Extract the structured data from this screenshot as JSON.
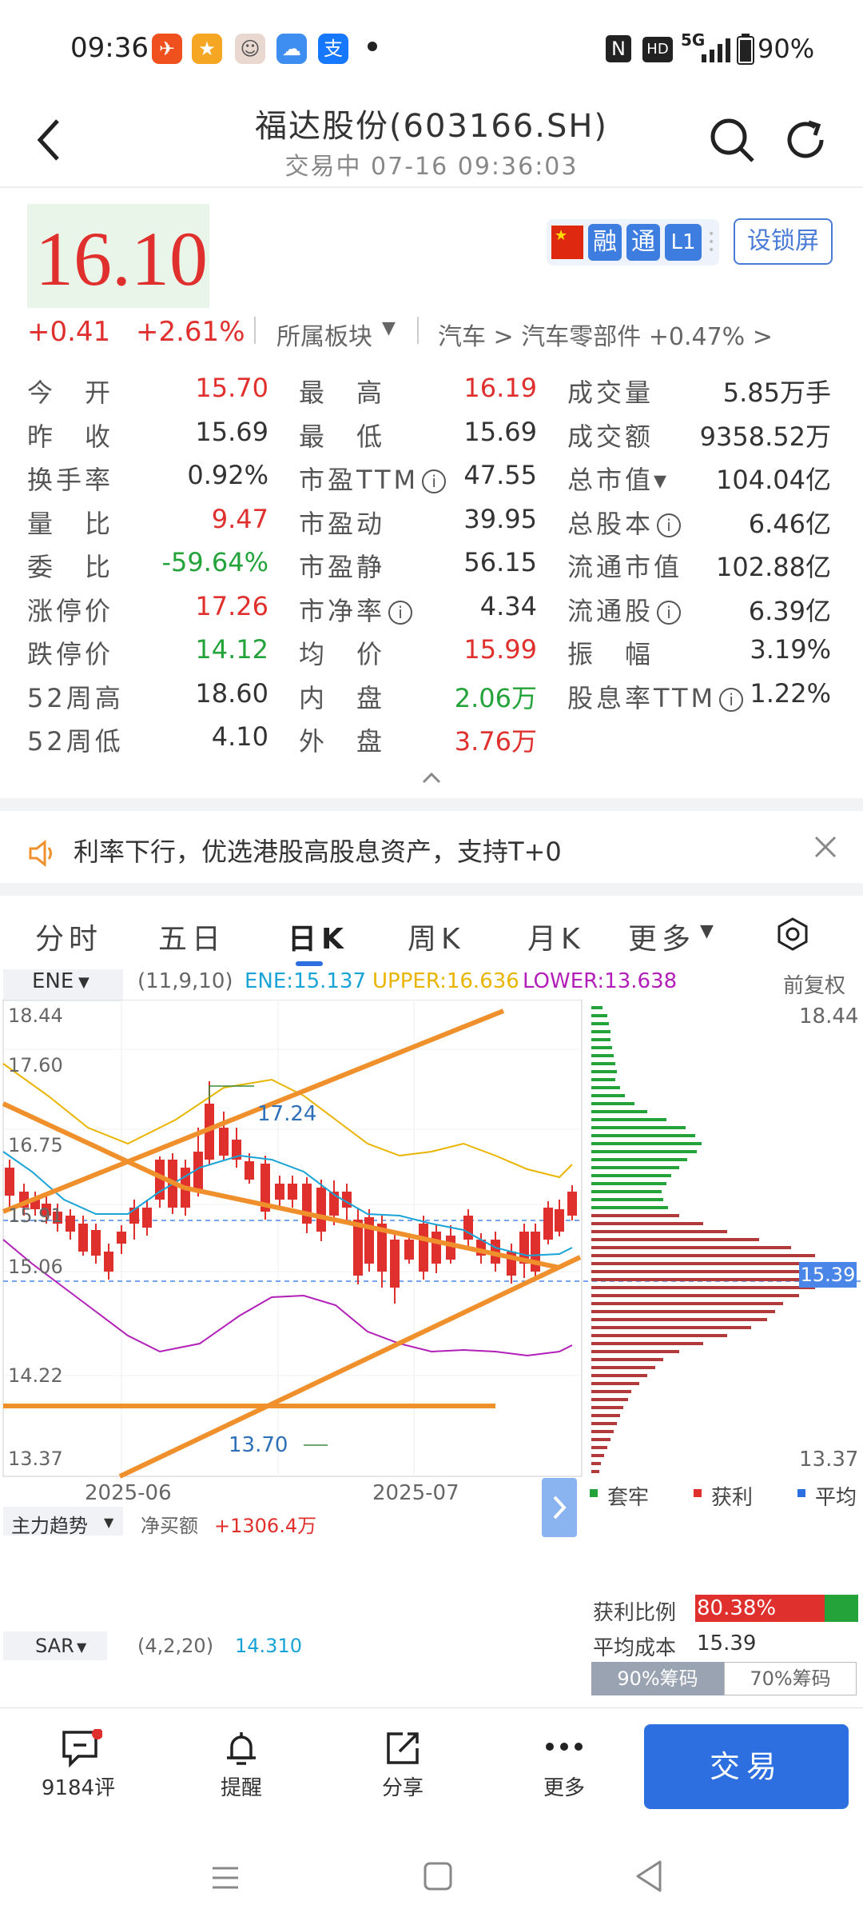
{
  "status_bar": {
    "time": "09:36",
    "battery": "90%",
    "network": "5G",
    "hd": "HD",
    "nfc": "N"
  },
  "nav": {
    "title": "福达股份(603166.SH)",
    "subtitle": "交易中 07-16 09:36:03"
  },
  "quote": {
    "price": "16.10",
    "change": "+0.41",
    "change_pct": "+2.61%",
    "sector_label": "所属板块",
    "sector_path": "汽车 > 汽车零部件 +0.47% >",
    "tags": [
      "融",
      "通",
      "L1"
    ],
    "lock_button": "设锁屏"
  },
  "stats": [
    {
      "label": "今　开",
      "value": "15.70",
      "color": "red"
    },
    {
      "label": "最　高",
      "value": "16.19",
      "color": "red"
    },
    {
      "label": "成交量",
      "value": "5.85万手",
      "color": "dark"
    },
    {
      "label": "昨　收",
      "value": "15.69",
      "color": "dark"
    },
    {
      "label": "最　低",
      "value": "15.69",
      "color": "dark"
    },
    {
      "label": "成交额",
      "value": "9358.52万",
      "color": "dark"
    },
    {
      "label": "换手率",
      "value": "0.92%",
      "color": "dark"
    },
    {
      "label": "市盈TTM",
      "value": "47.55",
      "color": "dark"
    },
    {
      "label": "总市值▾",
      "value": "104.04亿",
      "color": "dark"
    },
    {
      "label": "量　比",
      "value": "9.47",
      "color": "red"
    },
    {
      "label": "市盈动",
      "value": "39.95",
      "color": "dark"
    },
    {
      "label": "总股本",
      "value": "6.46亿",
      "color": "dark"
    },
    {
      "label": "委　比",
      "value": "-59.64%",
      "color": "green"
    },
    {
      "label": "市盈静",
      "value": "56.15",
      "color": "dark"
    },
    {
      "label": "流通市值",
      "value": "102.88亿",
      "color": "dark"
    },
    {
      "label": "涨停价",
      "value": "17.26",
      "color": "red"
    },
    {
      "label": "市净率",
      "value": "4.34",
      "color": "dark"
    },
    {
      "label": "流通股",
      "value": "6.39亿",
      "color": "dark"
    },
    {
      "label": "跌停价",
      "value": "14.12",
      "color": "green"
    },
    {
      "label": "均　价",
      "value": "15.99",
      "color": "red"
    },
    {
      "label": "振　幅",
      "value": "3.19%",
      "color": "dark"
    },
    {
      "label": "52周高",
      "value": "18.60",
      "color": "dark"
    },
    {
      "label": "内　盘",
      "value": "2.06万",
      "color": "green"
    },
    {
      "label": "股息率TTM",
      "value": "1.22%",
      "color": "dark"
    },
    {
      "label": "52周低",
      "value": "4.10",
      "color": "dark"
    },
    {
      "label": "外　盘",
      "value": "3.76万",
      "color": "red"
    }
  ],
  "notice": {
    "text": "利率下行，优选港股高股息资产，支持T+0"
  },
  "tabs": [
    "分时",
    "五日",
    "日K",
    "周K",
    "月K",
    "更多"
  ],
  "active_tab": "日K",
  "chart_header": {
    "indicator": "ENE",
    "params": "(11,9,10)",
    "ene": "ENE:15.137",
    "upper": "UPPER:16.636",
    "lower": "LOWER:13.638",
    "adjust": "前复权"
  },
  "chart_data": {
    "type": "candlestick",
    "y_ticks": [
      "18.44",
      "17.60",
      "16.75",
      "15.91",
      "15.06",
      "14.22",
      "13.37"
    ],
    "x_ticks": [
      "2025-06",
      "2025-07"
    ],
    "annotations": [
      "17.24",
      "13.70"
    ],
    "current_price_tag": "15.39",
    "profile_max": "18.44",
    "profile_min": "13.37"
  },
  "chip_legend": [
    "套牢",
    "获利",
    "平均"
  ],
  "chip_stats": {
    "profit_label": "获利比例",
    "profit_value": "80.38%",
    "avg_cost_label": "平均成本",
    "avg_cost_value": "15.39",
    "tab90": "90%筹码",
    "tab70": "70%筹码"
  },
  "main_trend": {
    "label": "主力趋势",
    "net_label": "净买额",
    "net_value": "+1306.4万"
  },
  "sar": {
    "label": "SAR",
    "params": "(4,2,20)",
    "value": "14.310"
  },
  "bottom_bar": {
    "comments": "9184评",
    "alert": "提醒",
    "share": "分享",
    "more": "更多",
    "trade": "交易"
  },
  "colors": {
    "up": "#e0302d",
    "down": "#23a33a",
    "ene_line": "#1aa3d6",
    "upper_line": "#e9b400",
    "lower_line": "#b21fb8",
    "trend_line": "#f0902c",
    "accent": "#2d6fe0"
  }
}
